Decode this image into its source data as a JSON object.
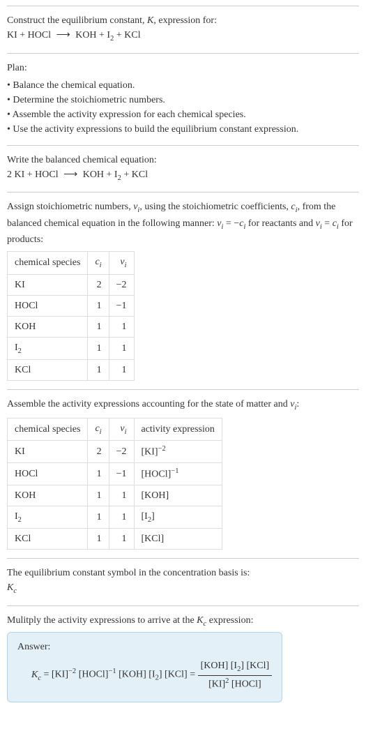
{
  "title_line1": "Construct the equilibrium constant, K, expression for:",
  "equation_unbalanced": "KI + HOCl  ⟶  KOH + I₂ + KCl",
  "plan_label": "Plan:",
  "plan_items": [
    "Balance the chemical equation.",
    "Determine the stoichiometric numbers.",
    "Assemble the activity expression for each chemical species.",
    "Use the activity expressions to build the equilibrium constant expression."
  ],
  "balanced_intro": "Write the balanced chemical equation:",
  "equation_balanced": "2 KI + HOCl  ⟶  KOH + I₂ + KCl",
  "stoich_intro_1": "Assign stoichiometric numbers, νᵢ, using the stoichiometric coefficients, cᵢ, from the balanced chemical equation in the following manner: νᵢ = −cᵢ for reactants and νᵢ = cᵢ for products:",
  "table1": {
    "headers": [
      "chemical species",
      "cᵢ",
      "νᵢ"
    ],
    "rows": [
      [
        "KI",
        "2",
        "−2"
      ],
      [
        "HOCl",
        "1",
        "−1"
      ],
      [
        "KOH",
        "1",
        "1"
      ],
      [
        "I₂",
        "1",
        "1"
      ],
      [
        "KCl",
        "1",
        "1"
      ]
    ]
  },
  "activity_intro": "Assemble the activity expressions accounting for the state of matter and νᵢ:",
  "table2": {
    "headers": [
      "chemical species",
      "cᵢ",
      "νᵢ",
      "activity expression"
    ],
    "rows": [
      [
        "KI",
        "2",
        "−2",
        "[KI]⁻²"
      ],
      [
        "HOCl",
        "1",
        "−1",
        "[HOCl]⁻¹"
      ],
      [
        "KOH",
        "1",
        "1",
        "[KOH]"
      ],
      [
        "I₂",
        "1",
        "1",
        "[I₂]"
      ],
      [
        "KCl",
        "1",
        "1",
        "[KCl]"
      ]
    ]
  },
  "symbol_intro": "The equilibrium constant symbol in the concentration basis is:",
  "symbol": "K_c",
  "multiply_intro": "Mulitply the activity expressions to arrive at the K_c expression:",
  "answer_label": "Answer:",
  "kc_prefix": "K_c = ",
  "kc_flat": "[KI]⁻² [HOCl]⁻¹ [KOH] [I₂] [KCl] = ",
  "kc_frac_num": "[KOH] [I₂] [KCl]",
  "kc_frac_den": "[KI]² [HOCl]",
  "chart_data": {
    "type": "table",
    "tables": [
      {
        "title": "stoichiometric numbers",
        "columns": [
          "chemical species",
          "c_i",
          "nu_i"
        ],
        "rows": [
          {
            "chemical species": "KI",
            "c_i": 2,
            "nu_i": -2
          },
          {
            "chemical species": "HOCl",
            "c_i": 1,
            "nu_i": -1
          },
          {
            "chemical species": "KOH",
            "c_i": 1,
            "nu_i": 1
          },
          {
            "chemical species": "I2",
            "c_i": 1,
            "nu_i": 1
          },
          {
            "chemical species": "KCl",
            "c_i": 1,
            "nu_i": 1
          }
        ]
      },
      {
        "title": "activity expressions",
        "columns": [
          "chemical species",
          "c_i",
          "nu_i",
          "activity expression"
        ],
        "rows": [
          {
            "chemical species": "KI",
            "c_i": 2,
            "nu_i": -2,
            "activity expression": "[KI]^-2"
          },
          {
            "chemical species": "HOCl",
            "c_i": 1,
            "nu_i": -1,
            "activity expression": "[HOCl]^-1"
          },
          {
            "chemical species": "KOH",
            "c_i": 1,
            "nu_i": 1,
            "activity expression": "[KOH]"
          },
          {
            "chemical species": "I2",
            "c_i": 1,
            "nu_i": 1,
            "activity expression": "[I2]"
          },
          {
            "chemical species": "KCl",
            "c_i": 1,
            "nu_i": 1,
            "activity expression": "[KCl]"
          }
        ]
      }
    ]
  }
}
